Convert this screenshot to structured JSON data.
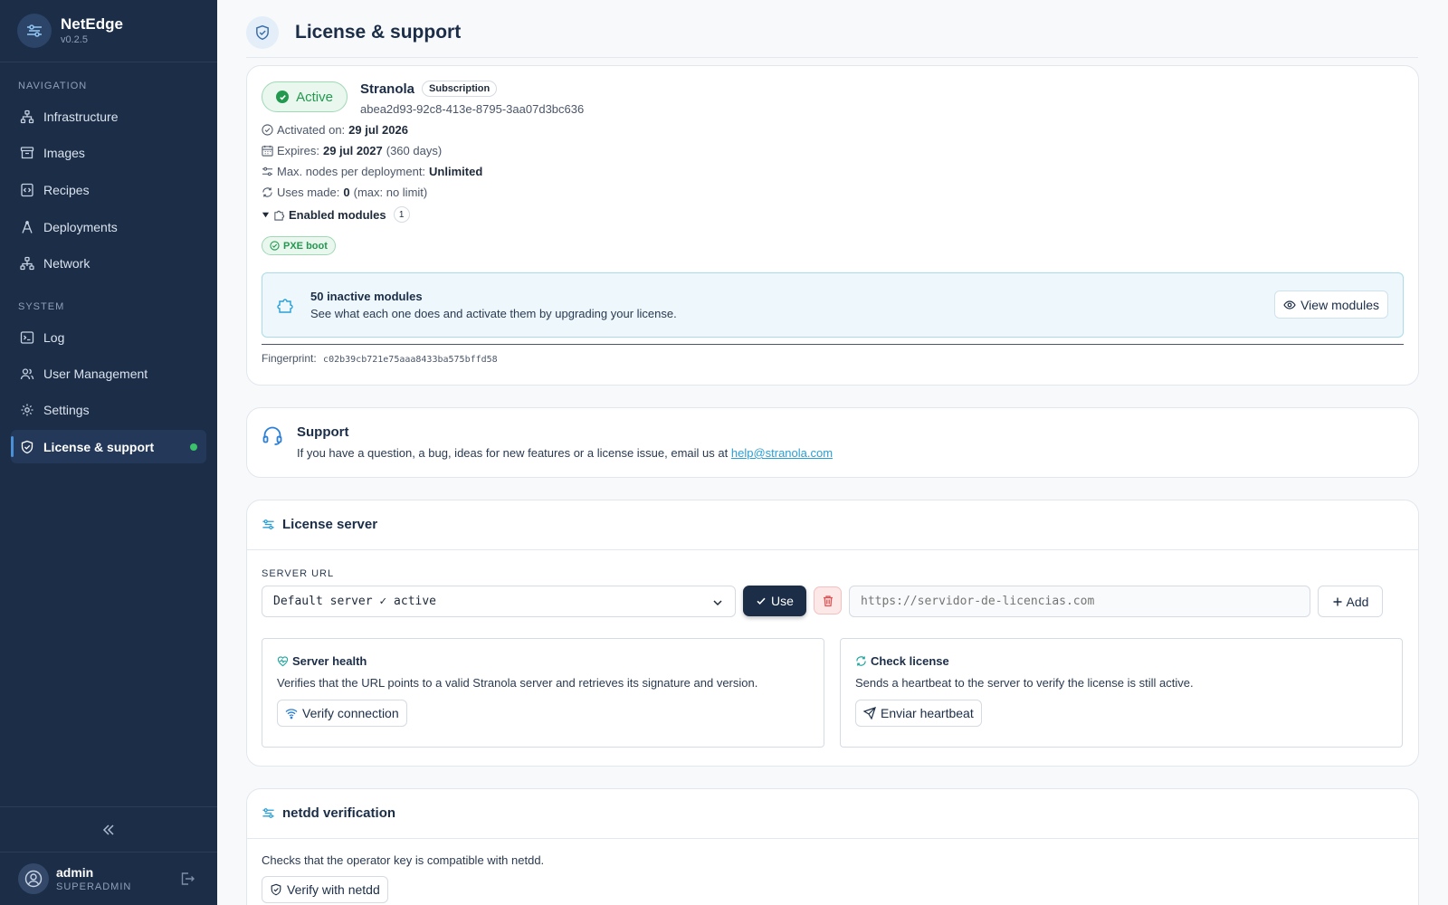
{
  "app": {
    "name": "NetEdge",
    "version": "v0.2.5"
  },
  "sidebar": {
    "nav_section": "NAVIGATION",
    "system_section": "SYSTEM",
    "nav_items": [
      {
        "label": "Infrastructure",
        "icon": "infrastructure-icon"
      },
      {
        "label": "Images",
        "icon": "archive-icon"
      },
      {
        "label": "Recipes",
        "icon": "code-file-icon"
      },
      {
        "label": "Deployments",
        "icon": "deploy-icon"
      },
      {
        "label": "Network",
        "icon": "network-icon"
      }
    ],
    "system_items": [
      {
        "label": "Log",
        "icon": "terminal-icon"
      },
      {
        "label": "User Management",
        "icon": "users-icon"
      },
      {
        "label": "Settings",
        "icon": "gear-icon"
      },
      {
        "label": "License & support",
        "icon": "shield-check-icon",
        "active": true
      }
    ]
  },
  "user": {
    "name": "admin",
    "role": "SUPERADMIN"
  },
  "page": {
    "title": "License & support"
  },
  "license": {
    "status": "Active",
    "vendor": "Stranola",
    "type_badge": "Subscription",
    "id": "abea2d93-92c8-413e-8795-3aa07d3bc636",
    "activated_label": "Activated on:",
    "activated_value": "29 jul 2026",
    "expires_label": "Expires:",
    "expires_value": "29 jul 2027",
    "expires_note": "(360 days)",
    "max_nodes_label": "Max. nodes per deployment:",
    "max_nodes_value": "Unlimited",
    "uses_label": "Uses made:",
    "uses_value": "0",
    "uses_note": "(max: no limit)",
    "modules_label": "Enabled modules",
    "modules_count": "1",
    "enabled_modules": [
      "PXE boot"
    ],
    "inactive_title": "50 inactive modules",
    "inactive_desc": "See what each one does and activate them by upgrading your license.",
    "view_modules_label": "View modules",
    "fingerprint_label": "Fingerprint:",
    "fingerprint_value": "c02b39cb721e75aaa8433ba575bffd58"
  },
  "support": {
    "title": "Support",
    "text": "If you have a question, a bug, ideas for new features or a license issue, email us at",
    "email": "help@stranola.com"
  },
  "license_server": {
    "title": "License server",
    "url_label": "SERVER URL",
    "selected": "Default server ✓ active",
    "use_label": "Use",
    "url_placeholder": "https://servidor-de-licencias.com",
    "add_label": "Add",
    "health_title": "Server health",
    "health_desc": "Verifies that the URL points to a valid Stranola server and retrieves its signature and version.",
    "health_button": "Verify connection",
    "check_title": "Check license",
    "check_desc": "Sends a heartbeat to the server to verify the license is still active.",
    "check_button": "Enviar heartbeat"
  },
  "netdd": {
    "title": "netdd verification",
    "desc": "Checks that the operator key is compatible with netdd.",
    "button": "Verify with netdd"
  },
  "colors": {
    "sidebar_bg": "#1b2d47",
    "accent_green": "#22994f",
    "accent_blue": "#2b9fd4",
    "danger": "#e05252"
  }
}
